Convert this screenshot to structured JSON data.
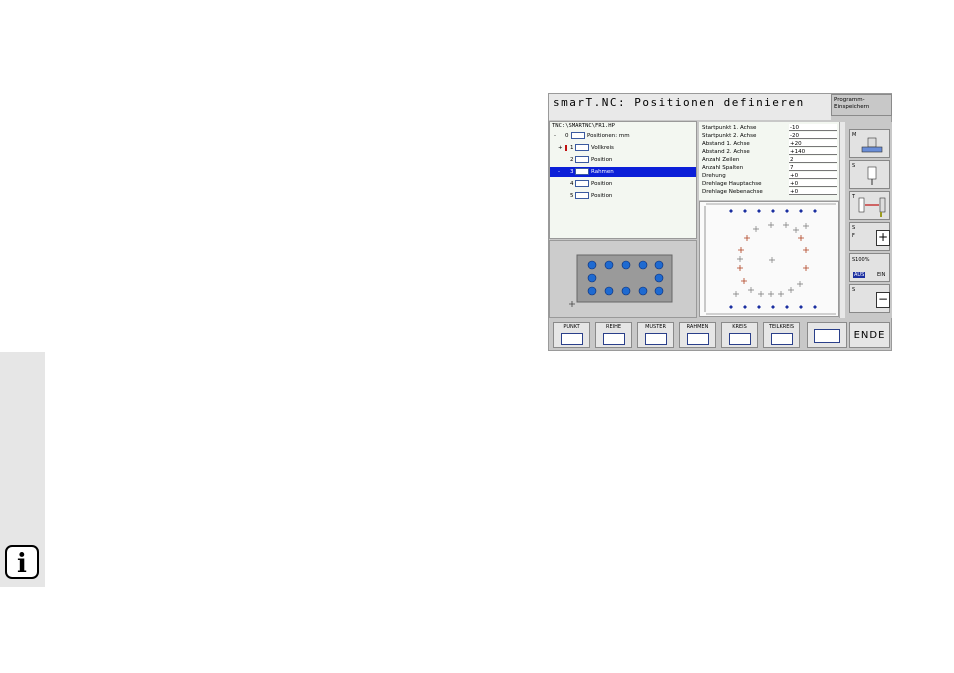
{
  "app": {
    "title": "smarT.NC: Positionen definieren",
    "save_label_1": "Programm-",
    "save_label_2": "Einspeichern"
  },
  "tree": {
    "path": "TNC:\\SMARTNC\\FR1.HP",
    "items": [
      {
        "num": "0",
        "label": "Positionen: mm",
        "marker": "-"
      },
      {
        "num": "1",
        "label": "Vollkreis",
        "marker": "+"
      },
      {
        "num": "2",
        "label": "Position",
        "marker": ""
      },
      {
        "num": "3",
        "label": "Rahmen",
        "marker": "-"
      },
      {
        "num": "4",
        "label": "Position",
        "marker": ""
      },
      {
        "num": "5",
        "label": "Position",
        "marker": ""
      }
    ]
  },
  "params": [
    {
      "label": "Startpunkt 1. Achse",
      "value": "-10"
    },
    {
      "label": "Startpunkt 2. Achse",
      "value": "-20"
    },
    {
      "label": "Abstand 1. Achse",
      "value": "+20"
    },
    {
      "label": "Abstand 2. Achse",
      "value": "+140"
    },
    {
      "label": "Anzahl Zeilen",
      "value": "2"
    },
    {
      "label": "Anzahl Spalten",
      "value": "7"
    },
    {
      "label": "Drehung",
      "value": "+0"
    },
    {
      "label": "Drehlage Hauptachse",
      "value": "+0"
    },
    {
      "label": "Drehlage Nebenachse",
      "value": "+0"
    }
  ],
  "right_panel": {
    "m_label": "M",
    "s1_label": "S",
    "t_label": "T",
    "s2_label": "S",
    "f_label": "F",
    "override": "S100%",
    "aus": "AUS",
    "ein": "EIN",
    "s3_label": "S",
    "plus": "+",
    "minus": "−"
  },
  "softkeys": [
    {
      "label": "PUNKT"
    },
    {
      "label": "REIHE"
    },
    {
      "label": "MUSTER"
    },
    {
      "label": "RAHMEN"
    },
    {
      "label": "KREIS"
    },
    {
      "label": "TEILKREIS"
    }
  ],
  "ende": "ENDE",
  "info_glyph": "i",
  "colors": {
    "selection": "#0b1fd8",
    "accent": "#1e6ad1",
    "pattern_blue": "#1b2fa0",
    "pattern_red": "#b04020"
  }
}
